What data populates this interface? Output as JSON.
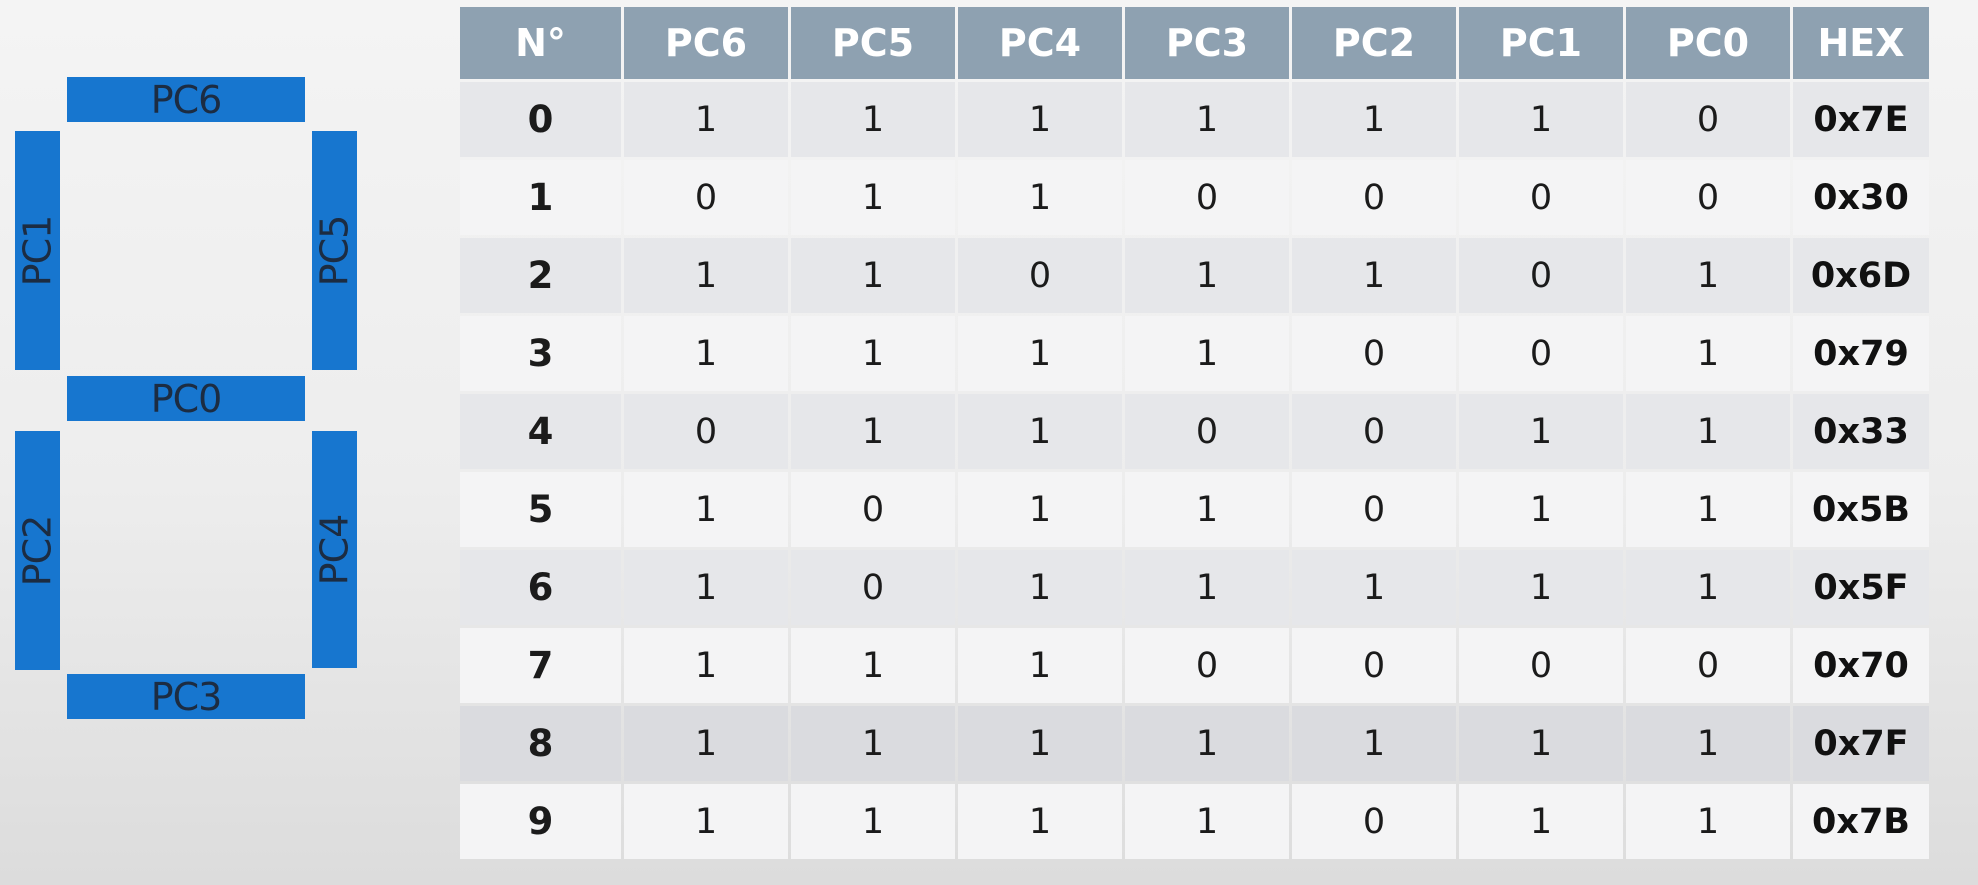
{
  "segments": {
    "pc6": "PC6",
    "pc1": "PC1",
    "pc5": "PC5",
    "pc0": "PC0",
    "pc2": "PC2",
    "pc4": "PC4",
    "pc3": "PC3",
    "color": "#1776cf"
  },
  "table": {
    "header_color": "#8ea1b1",
    "headers": [
      "N°",
      "PC6",
      "PC5",
      "PC4",
      "PC3",
      "PC2",
      "PC1",
      "PC0",
      "HEX"
    ],
    "rows": [
      {
        "n": "0",
        "bits": [
          "1",
          "1",
          "1",
          "1",
          "1",
          "1",
          "0"
        ],
        "hex": "0x7E"
      },
      {
        "n": "1",
        "bits": [
          "0",
          "1",
          "1",
          "0",
          "0",
          "0",
          "0"
        ],
        "hex": "0x30"
      },
      {
        "n": "2",
        "bits": [
          "1",
          "1",
          "0",
          "1",
          "1",
          "0",
          "1"
        ],
        "hex": "0x6D"
      },
      {
        "n": "3",
        "bits": [
          "1",
          "1",
          "1",
          "1",
          "0",
          "0",
          "1"
        ],
        "hex": "0x79"
      },
      {
        "n": "4",
        "bits": [
          "0",
          "1",
          "1",
          "0",
          "0",
          "1",
          "1"
        ],
        "hex": "0x33"
      },
      {
        "n": "5",
        "bits": [
          "1",
          "0",
          "1",
          "1",
          "0",
          "1",
          "1"
        ],
        "hex": "0x5B"
      },
      {
        "n": "6",
        "bits": [
          "1",
          "0",
          "1",
          "1",
          "1",
          "1",
          "1"
        ],
        "hex": "0x5F"
      },
      {
        "n": "7",
        "bits": [
          "1",
          "1",
          "1",
          "0",
          "0",
          "0",
          "0"
        ],
        "hex": "0x70"
      },
      {
        "n": "8",
        "bits": [
          "1",
          "1",
          "1",
          "1",
          "1",
          "1",
          "1"
        ],
        "hex": "0x7F"
      },
      {
        "n": "9",
        "bits": [
          "1",
          "1",
          "1",
          "1",
          "0",
          "1",
          "1"
        ],
        "hex": "0x7B"
      }
    ]
  }
}
